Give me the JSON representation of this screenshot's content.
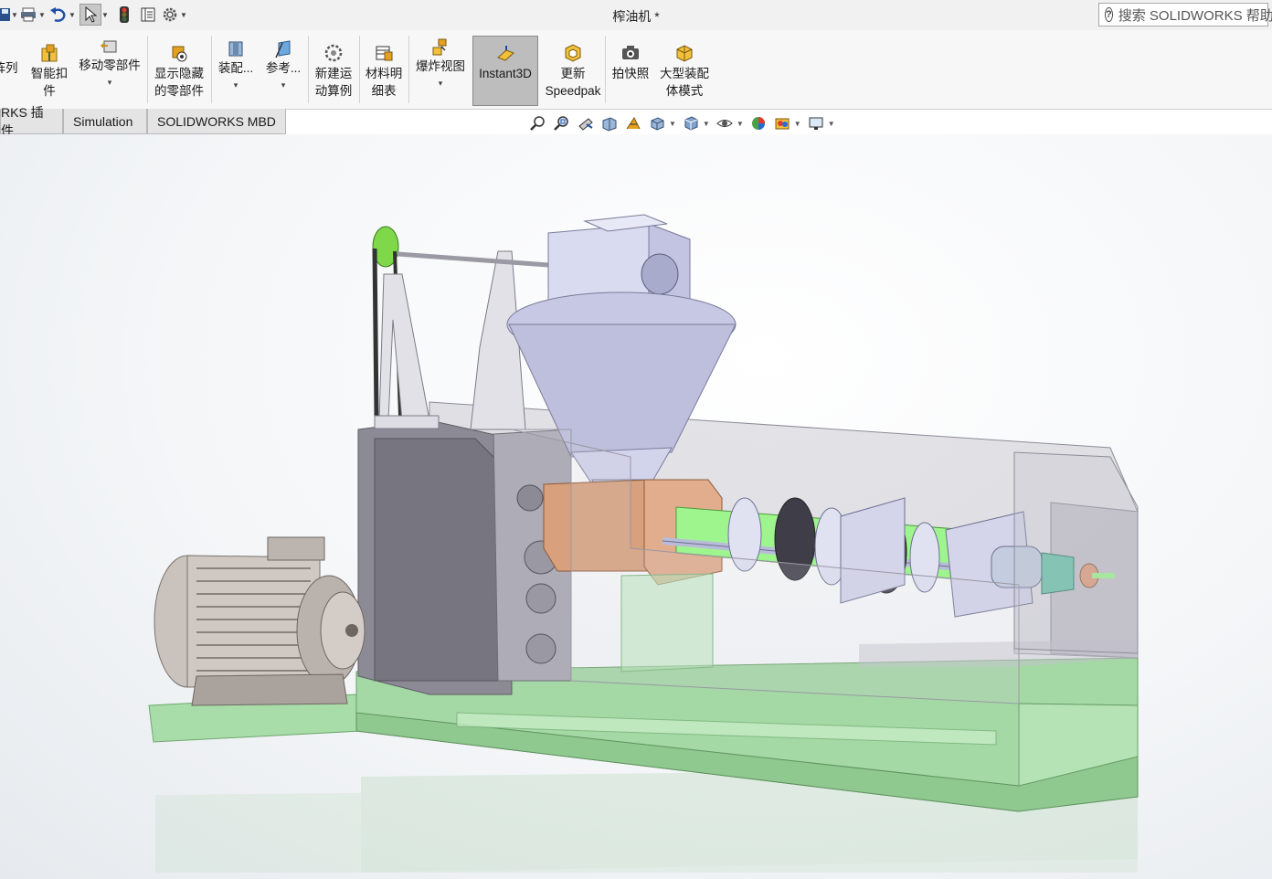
{
  "titlebar": {
    "document_title": "榨油机 *",
    "search_placeholder": "搜索 SOLIDWORKS 帮助"
  },
  "quick_access": [
    {
      "name": "save",
      "icon": "save-icon"
    },
    {
      "name": "print",
      "icon": "print-icon"
    },
    {
      "name": "undo",
      "icon": "undo-icon"
    },
    {
      "name": "select",
      "icon": "select-cursor-icon"
    },
    {
      "name": "rebuild",
      "icon": "traffic-light-icon"
    },
    {
      "name": "file-properties",
      "icon": "file-properties-icon"
    },
    {
      "name": "options",
      "icon": "gear-icon"
    }
  ],
  "command_manager": {
    "items": [
      {
        "label": "阵列",
        "icon": "pattern-icon",
        "has_dropdown": false
      },
      {
        "label": "智能扣\n件",
        "icon": "smart-fasteners-icon",
        "has_dropdown": false
      },
      {
        "label": "移动零部件",
        "icon": "move-component-icon",
        "has_dropdown": true
      },
      {
        "label": "显示隐藏\n的零部件",
        "icon": "show-hidden-components-icon",
        "has_dropdown": false
      },
      {
        "label": "装配...",
        "icon": "assembly-features-icon",
        "has_dropdown": true
      },
      {
        "label": "参考...",
        "icon": "reference-geometry-icon",
        "has_dropdown": true
      },
      {
        "label": "新建运\n动算例",
        "icon": "new-motion-study-icon",
        "has_dropdown": false
      },
      {
        "label": "材料明\n细表",
        "icon": "bill-of-materials-icon",
        "has_dropdown": false
      },
      {
        "label": "爆炸视图",
        "icon": "exploded-view-icon",
        "has_dropdown": true
      },
      {
        "label": "Instant3D",
        "icon": "instant3d-icon",
        "has_dropdown": false,
        "active": true
      },
      {
        "label": "更新\nSpeedpak",
        "icon": "update-speedpak-icon",
        "has_dropdown": false
      },
      {
        "label": "拍快照",
        "icon": "snapshot-icon",
        "has_dropdown": false
      },
      {
        "label": "大型装配\n体模式",
        "icon": "large-assembly-mode-icon",
        "has_dropdown": false
      }
    ]
  },
  "tabs": [
    {
      "label": "RKS 插件"
    },
    {
      "label": "Simulation"
    },
    {
      "label": "SOLIDWORKS MBD"
    }
  ],
  "view_toolbar": [
    {
      "icon": "zoom-to-fit-icon"
    },
    {
      "icon": "zoom-to-area-icon"
    },
    {
      "icon": "previous-view-icon"
    },
    {
      "icon": "section-view-icon"
    },
    {
      "icon": "dynamic-annotation-icon"
    },
    {
      "icon": "view-orientation-icon"
    },
    {
      "icon": "display-style-icon"
    },
    {
      "icon": "hide-show-items-icon"
    },
    {
      "icon": "edit-appearance-icon"
    },
    {
      "icon": "apply-scene-icon"
    },
    {
      "icon": "view-settings-icon"
    }
  ],
  "colors": {
    "active_tool_bg": "#bdbdbd",
    "base_green": "#a8dca8",
    "housing_grey": "#9a98a4",
    "hopper_lavender": "#c6c8e4",
    "barrel_copper": "#d8a07c",
    "screw_green": "#9ef58e",
    "motor_grey": "#c4bdb8"
  }
}
